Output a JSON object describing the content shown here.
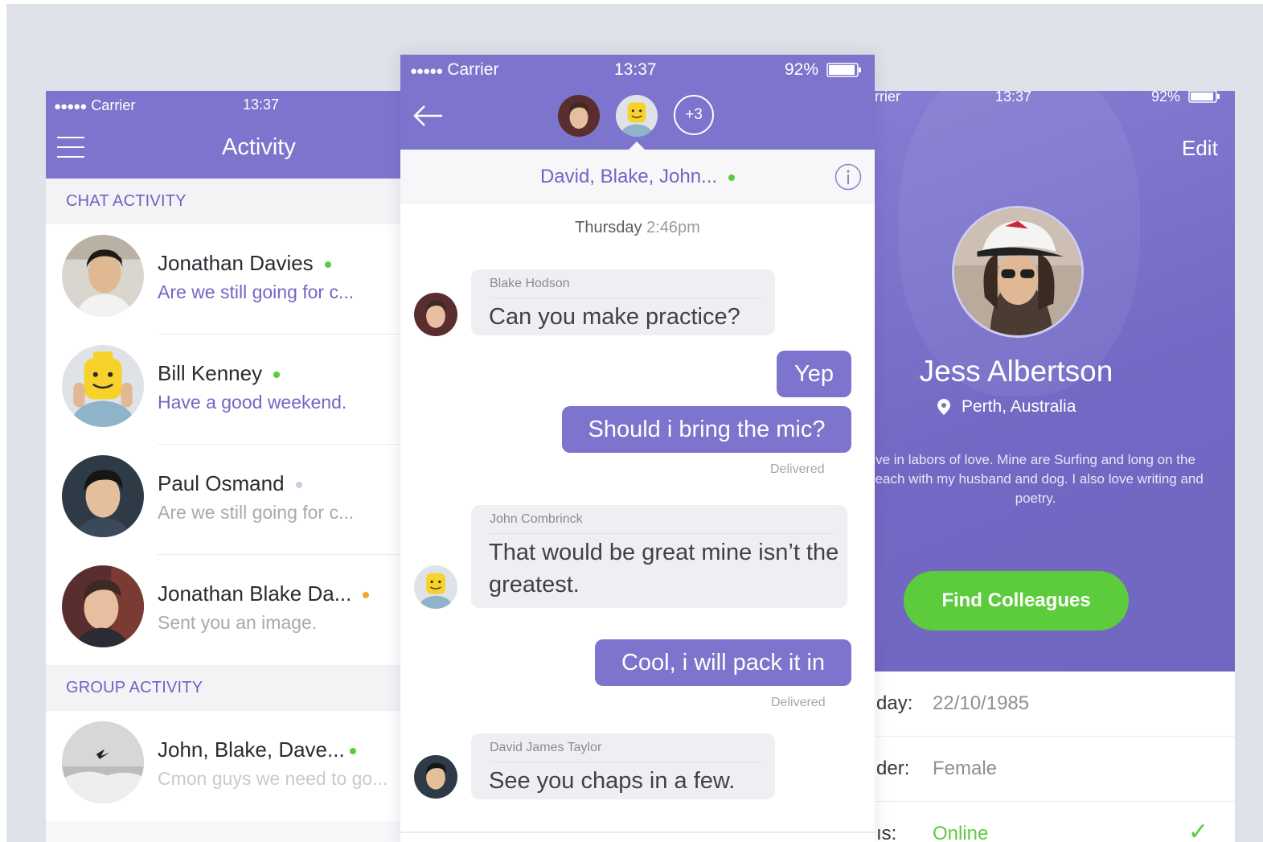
{
  "left": {
    "status": {
      "carrier": "Carrier",
      "time": "13:37"
    },
    "title": "Activity",
    "chat_section": "CHAT ACTIVITY",
    "group_section": "GROUP ACTIVITY",
    "chats": [
      {
        "name": "Jonathan Davies",
        "message": "Are we still going for c...",
        "status": "online"
      },
      {
        "name": "Bill Kenney",
        "message": "Have a good weekend.",
        "status": "online"
      },
      {
        "name": "Paul Osmand",
        "message": "Are we still going for c...",
        "status": "offline"
      },
      {
        "name": "Jonathan Blake Da...",
        "message": "Sent you an image.",
        "status": "away"
      }
    ],
    "groups": [
      {
        "name": "John, Blake, Dave...",
        "message": "Cmon guys we need to go...",
        "status": "online"
      }
    ]
  },
  "center": {
    "status": {
      "carrier": "Carrier",
      "time": "13:37",
      "battery": "92%"
    },
    "extra_count": "+3",
    "participants": "David, Blake, John...",
    "day": "Thursday",
    "time": "2:46pm",
    "messages": [
      {
        "sender": "Blake Hodson",
        "text": "Can you make practice?"
      },
      {
        "text": "Yep"
      },
      {
        "text": "Should i bring the mic?",
        "status": "Delivered"
      },
      {
        "sender": "John Combrinck",
        "text": "That would be great mine isn’t the greatest."
      },
      {
        "text": "Cool, i will pack it in",
        "status": "Delivered"
      },
      {
        "sender": "David James Taylor",
        "text": "See you chaps in a few."
      }
    ]
  },
  "right": {
    "status": {
      "carrier": "rrier",
      "time": "13:37",
      "battery": "92%"
    },
    "edit": "Edit",
    "name": "Jess Albertson",
    "location": "Perth, Australia",
    "bio": "ve in labors of love. Mine are Surfing and long on the beach with my husband and dog. I also love writing and poetry.",
    "button": "Find Colleagues",
    "details": [
      {
        "label": "day:",
        "value": "22/10/1985"
      },
      {
        "label": "der:",
        "value": "Female"
      },
      {
        "label": "ıs:",
        "value": "Online"
      }
    ]
  },
  "colors": {
    "accent": "#7d75cd",
    "online": "#5ccb3c",
    "away": "#f0a830",
    "offline": "#c9cde0"
  }
}
